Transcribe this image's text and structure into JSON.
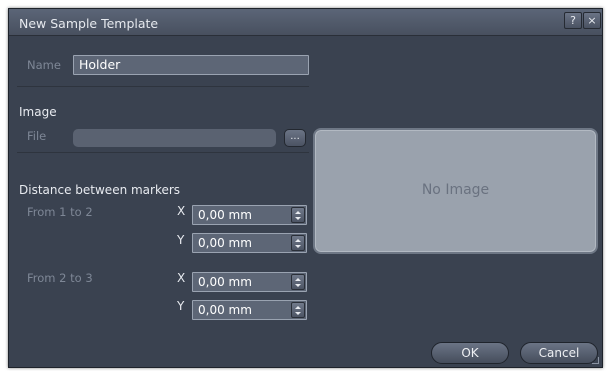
{
  "window": {
    "title": "New Sample Template",
    "help_label": "?",
    "close_label": "×"
  },
  "name": {
    "label": "Name",
    "value": "Holder"
  },
  "image": {
    "heading": "Image",
    "file_label": "File",
    "file_value": "",
    "browse_label": "...",
    "preview_text": "No Image"
  },
  "distance": {
    "heading": "Distance between markers",
    "groups": [
      {
        "label": "From 1 to 2",
        "x_label": "X",
        "x_value": "0,00 mm",
        "y_label": "Y",
        "y_value": "0,00 mm"
      },
      {
        "label": "From 2 to 3",
        "x_label": "X",
        "x_value": "0,00 mm",
        "y_label": "Y",
        "y_value": "0,00 mm"
      }
    ]
  },
  "actions": {
    "ok_label": "OK",
    "cancel_label": "Cancel"
  }
}
